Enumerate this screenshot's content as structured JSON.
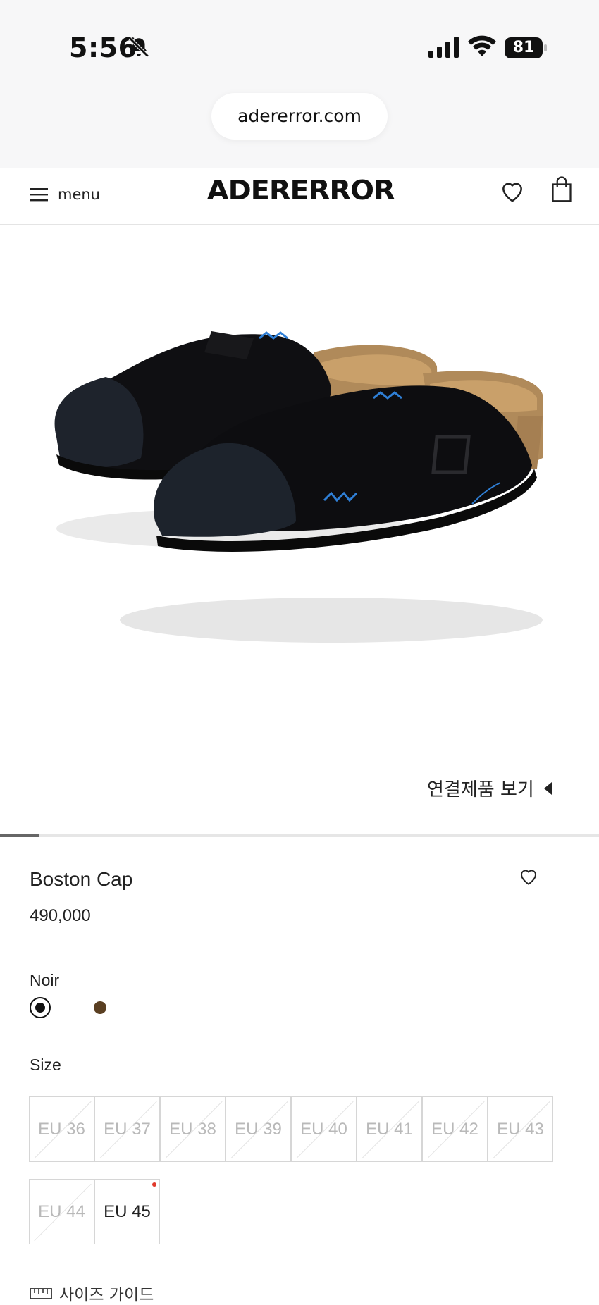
{
  "status_bar": {
    "time": "5:56",
    "battery": "81"
  },
  "browser": {
    "url": "adererror.com"
  },
  "header": {
    "menu_label": "menu",
    "logo": "ADERERROR"
  },
  "gallery": {
    "related_label": "연결제품 보기",
    "progress_fraction": 0.065
  },
  "product": {
    "name": "Boston Cap",
    "price": "490,000",
    "color_selected": "Noir",
    "colors": [
      {
        "name": "Noir",
        "hex": "#111111",
        "selected": true
      },
      {
        "name": "",
        "hex": "#5a3f22",
        "selected": false
      }
    ],
    "size_label": "Size",
    "sizes": [
      {
        "label": "EU 36",
        "available": false
      },
      {
        "label": "EU 37",
        "available": false
      },
      {
        "label": "EU 38",
        "available": false
      },
      {
        "label": "EU 39",
        "available": false
      },
      {
        "label": "EU 40",
        "available": false
      },
      {
        "label": "EU 41",
        "available": false
      },
      {
        "label": "EU 42",
        "available": false
      },
      {
        "label": "EU 43",
        "available": false
      },
      {
        "label": "EU 44",
        "available": false
      },
      {
        "label": "EU 45",
        "available": true
      }
    ],
    "size_guide_label": "사이즈 가이드"
  }
}
